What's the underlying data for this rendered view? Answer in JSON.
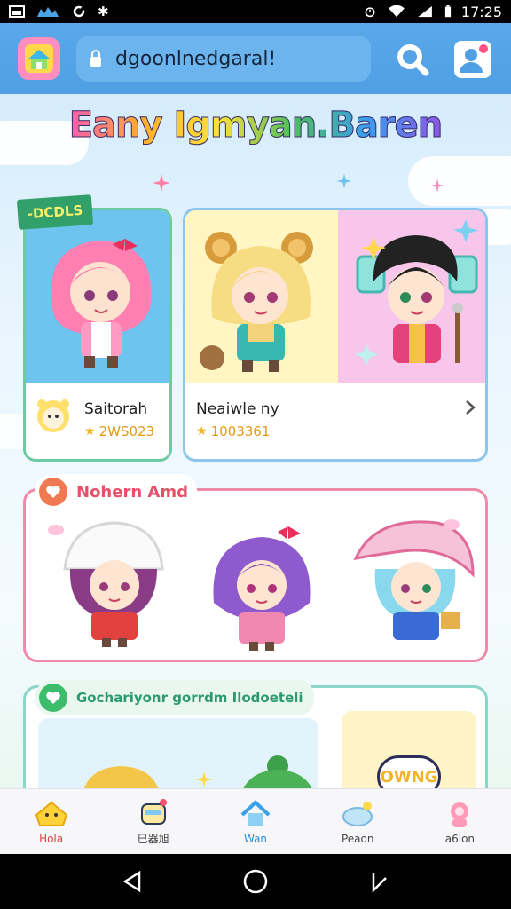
{
  "status_bar": {
    "time": "17:25",
    "left_icons": [
      "image-icon",
      "cloud-icon",
      "sync-icon",
      "settings-icon"
    ],
    "right_icons": [
      "alarm-icon",
      "wifi-icon",
      "signal-icon",
      "battery-icon"
    ]
  },
  "header": {
    "url_text": "dgoonlnedgaral!",
    "search_icon": "search-icon",
    "profile_icon": "profile-icon"
  },
  "hero": {
    "title": "Eany Igmyan.Baren"
  },
  "cards": [
    {
      "tag": "-DCDLS",
      "name": "Saitorah",
      "number": "2WS023",
      "bg": "#6cc4ef"
    },
    {
      "name": "Neaiwle ny",
      "number": "1003361",
      "chevron": "chevron-right-icon"
    }
  ],
  "sections": {
    "featured": {
      "label": "Nohern Amd",
      "badge_color": "#ef7a52",
      "icon": "heart-icon"
    },
    "second": {
      "label": "Gochariyonr gorrdm Ilodoeteli",
      "badge_color": "#3bbd6c",
      "icon": "heart-icon",
      "sign_text": "OWNG"
    }
  },
  "tabs": [
    {
      "label": "Hola",
      "icon": "home-icon",
      "active": true
    },
    {
      "label": "巳器旭",
      "icon": "gift-icon"
    },
    {
      "label": "Wan",
      "icon": "house-icon",
      "blue": true
    },
    {
      "label": "Peaon",
      "icon": "cloud-icon"
    },
    {
      "label": "a6lon",
      "icon": "character-icon"
    }
  ],
  "colors": {
    "header_bg": "#55a4e8",
    "title_gradient": [
      "#ff5cae",
      "#ffb02e",
      "#ffe13a",
      "#4dbf5b",
      "#3a9df0",
      "#8d56e6"
    ]
  },
  "nav": [
    "back-icon",
    "home-icon",
    "recents-icon"
  ]
}
